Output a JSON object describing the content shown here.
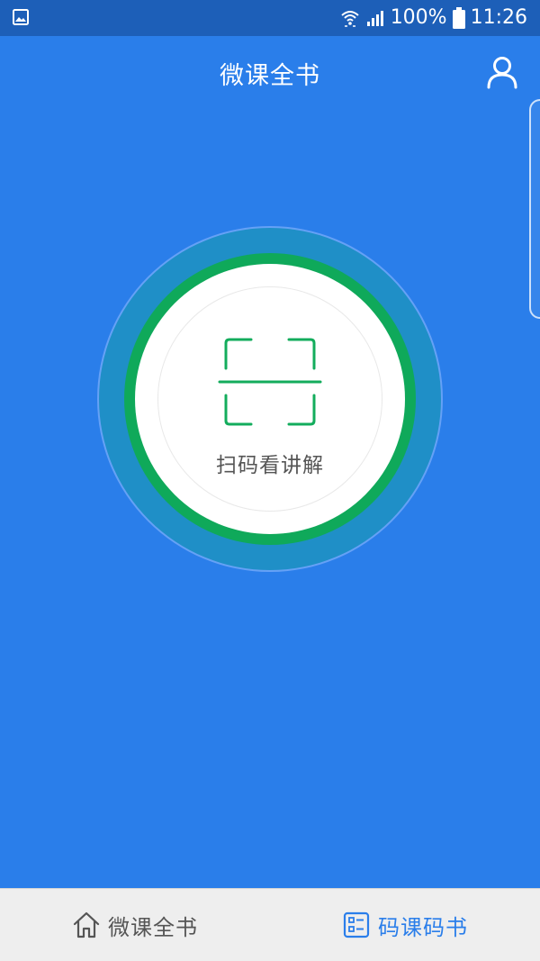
{
  "status_bar": {
    "battery": "100%",
    "time": "11:26",
    "icons": [
      "gallery-icon",
      "wifi-icon",
      "signal-icon",
      "battery-icon"
    ]
  },
  "header": {
    "title": "微课全书",
    "user_icon": "user-icon"
  },
  "scan": {
    "label": "扫码看讲解",
    "icon": "scan-frame-icon"
  },
  "bottom_nav": {
    "items": [
      {
        "label": "微课全书",
        "icon": "home-icon",
        "active": false
      },
      {
        "label": "码课码书",
        "icon": "checklist-icon",
        "active": true
      }
    ]
  },
  "colors": {
    "background": "#2a7eea",
    "status_bar": "#1d5fb8",
    "outer_ring": "#1f8fc7",
    "green_ring": "#0fa95a",
    "nav_active": "#2a7eea",
    "nav_inactive": "#555555"
  }
}
